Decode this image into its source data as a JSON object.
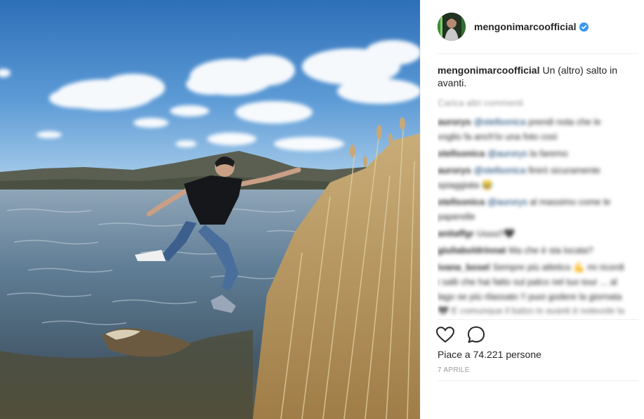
{
  "post": {
    "username": "mengonimarcoofficial",
    "verified": true,
    "caption_user": "mengonimarcoofficial",
    "caption_text": "Un (altro) salto in avanti.",
    "load_more": "Carica altri commenti",
    "comments": [
      {
        "user": "aurorys",
        "mention": "@stellsonica",
        "text": "prendi nota che le voglio fa anch'io una foto così"
      },
      {
        "user": "stellsonica",
        "mention": "@aurorys",
        "text": "la faremo"
      },
      {
        "user": "aurorys",
        "mention": "@stellsonica",
        "text": "finirò sicuramente spiaggiata 😂"
      },
      {
        "user": "stellsonica",
        "mention": "@aurorys",
        "text": "al massimo come le paperelle"
      },
      {
        "user": "anitaffgr",
        "mention": "",
        "text": "Uuuu!!🖤"
      },
      {
        "user": "giuliaboldrinnat",
        "mention": "",
        "text": "Ma che è sta locata?"
      },
      {
        "user": "ivana_bosel",
        "mention": "",
        "text": "Sempre più atletico 💪 mi ricordi i salti che hai fatto sul palco nel tuo tour ... al lago se più rilassato !! puoi godere la giornata 🖤 E comunque il balzo in avanti è notevole la primavera ti da la"
      }
    ],
    "likes_prefix": "Piace a",
    "likes_count": "74.221",
    "likes_suffix": "persone",
    "date": "7 APRILE",
    "icons": {
      "like": "heart-icon",
      "comment": "comment-bubble-icon",
      "verified": "verified-badge-icon"
    },
    "colors": {
      "verified": "#3897f0",
      "text": "#262626",
      "muted": "#999999",
      "separator": "#efefef"
    }
  }
}
